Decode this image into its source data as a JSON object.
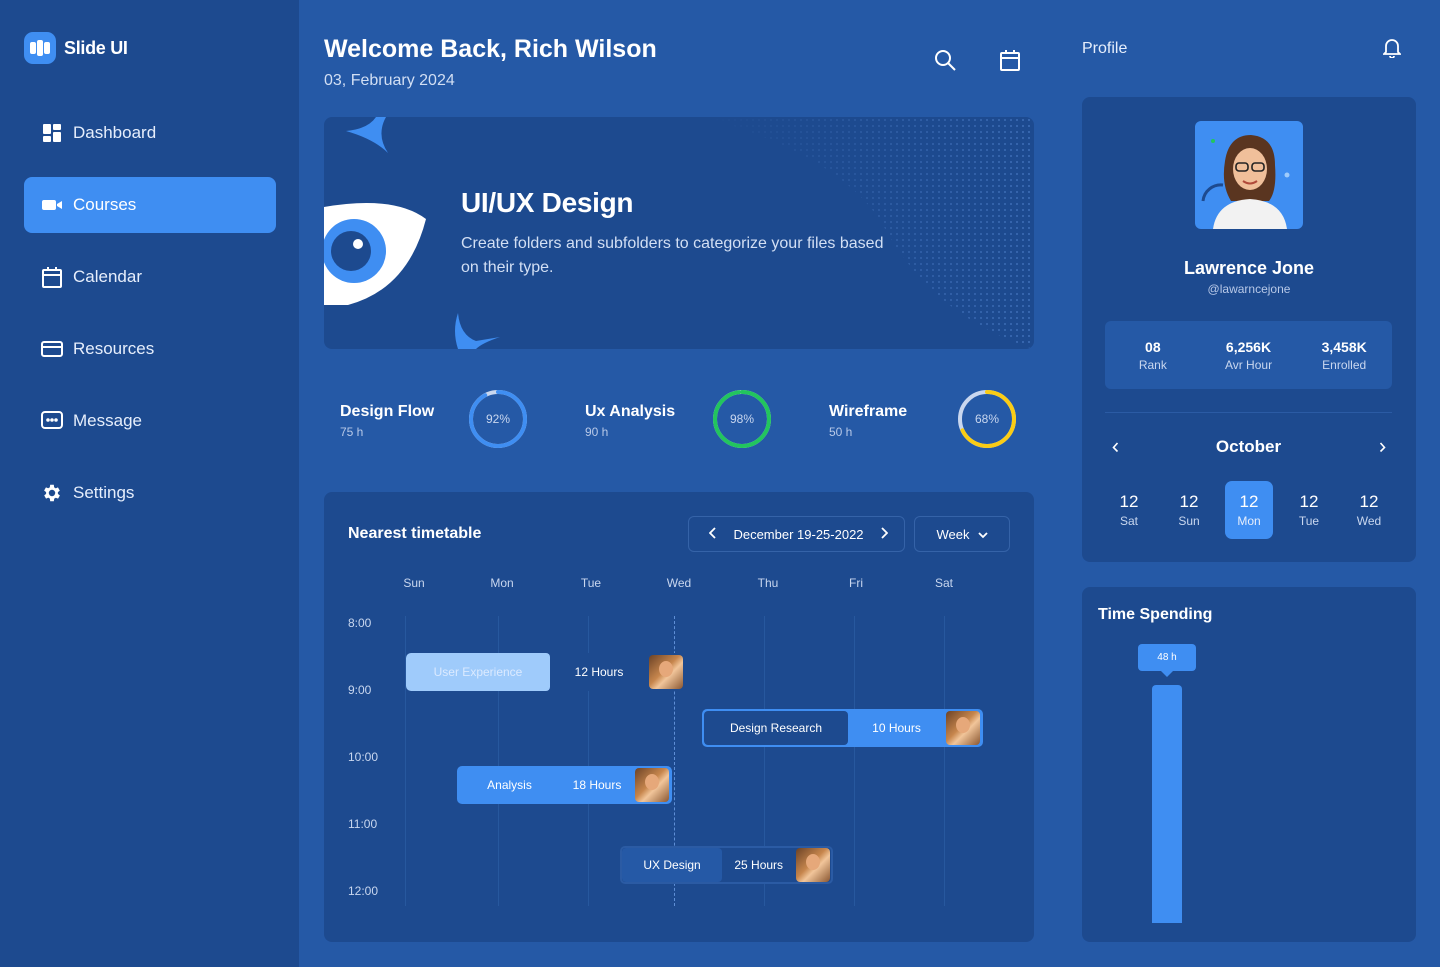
{
  "brand": {
    "name": "Slide UI"
  },
  "nav": [
    {
      "label": "Dashboard",
      "icon": "dashboard-icon"
    },
    {
      "label": "Courses",
      "icon": "video-icon",
      "active": true
    },
    {
      "label": "Calendar",
      "icon": "calendar-icon"
    },
    {
      "label": "Resources",
      "icon": "card-icon"
    },
    {
      "label": "Message",
      "icon": "message-icon"
    },
    {
      "label": "Settings",
      "icon": "gear-icon"
    }
  ],
  "header": {
    "welcome": "Welcome Back, Rich Wilson",
    "date": "03, February 2024"
  },
  "hero": {
    "title": "UI/UX Design",
    "description": "Create folders and subfolders to categorize your files based on their type."
  },
  "stats": [
    {
      "name": "Design Flow",
      "hours": "75 h",
      "percent_label": "92%",
      "percent": 92,
      "color": "#3f8ef2"
    },
    {
      "name": "Ux Analysis",
      "hours": "90 h",
      "percent_label": "98%",
      "percent": 98,
      "color": "#22c55e"
    },
    {
      "name": "Wireframe",
      "hours": "50 h",
      "percent_label": "68%",
      "percent": 68,
      "color": "#facc15"
    }
  ],
  "timetable": {
    "title": "Nearest timetable",
    "range": "December 19-25-2022",
    "view": "Week",
    "days": [
      "Sun",
      "Mon",
      "Tue",
      "Wed",
      "Thu",
      "Fri",
      "Sat"
    ],
    "times": [
      "8:00",
      "9:00",
      "10:00",
      "11:00",
      "12:00"
    ],
    "events": [
      {
        "name": "User Experience",
        "hours": "12 Hours"
      },
      {
        "name": "Design Research",
        "hours": "10 Hours"
      },
      {
        "name": "Analysis",
        "hours": "18 Hours"
      },
      {
        "name": "UX Design",
        "hours": "25 Hours"
      }
    ]
  },
  "profile": {
    "label": "Profile",
    "name": "Lawrence Jone",
    "handle": "@lawarncejone",
    "stats": [
      {
        "value": "08",
        "label": "Rank"
      },
      {
        "value": "6,256K",
        "label": "Avr Hour"
      },
      {
        "value": "3,458K",
        "label": "Enrolled"
      }
    ],
    "month": "October",
    "days": [
      {
        "num": "12",
        "name": "Sat"
      },
      {
        "num": "12",
        "name": "Sun"
      },
      {
        "num": "12",
        "name": "Mon",
        "selected": true
      },
      {
        "num": "12",
        "name": "Tue"
      },
      {
        "num": "12",
        "name": "Wed"
      }
    ]
  },
  "time_spending": {
    "title": "Time Spending",
    "value_label": "48 h",
    "value": 48
  }
}
